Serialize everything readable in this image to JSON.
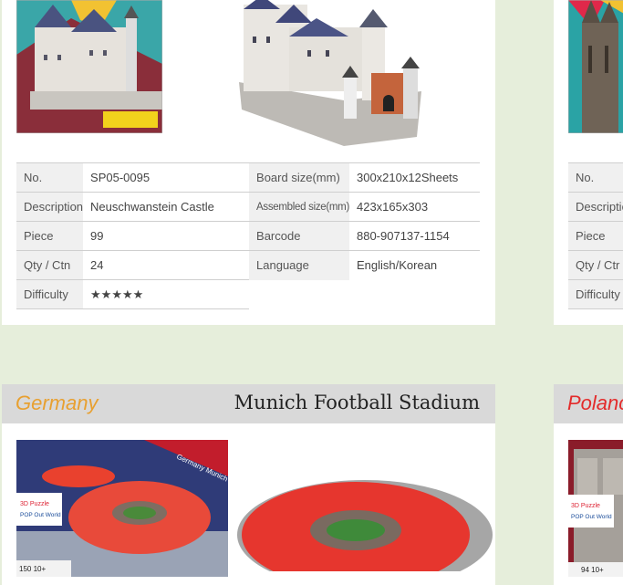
{
  "castle": {
    "spec_left": [
      {
        "label": "No.",
        "value": "SP05-0095"
      },
      {
        "label": "Description",
        "value": "Neuschwanstein Castle"
      },
      {
        "label": "Piece",
        "value": "99"
      },
      {
        "label": "Qty / Ctn",
        "value": "24"
      },
      {
        "label": "Difficulty",
        "value": "★★★★★"
      }
    ],
    "spec_right": [
      {
        "label": "Board size(mm)",
        "value": "300x210x12Sheets"
      },
      {
        "label": "Assembled size(mm)",
        "value": "423x165x303"
      },
      {
        "label": "Barcode",
        "value": "880-907137-1154"
      },
      {
        "label": "Language",
        "value": "English/Korean"
      }
    ]
  },
  "right_card_top": {
    "labels": [
      "No.",
      "Descriptior",
      "Piece",
      "Qty / Ctr",
      "Difficulty"
    ]
  },
  "stadium": {
    "country": "Germany",
    "title": "Munich Football Stadium",
    "box_ribbon": "Germany Munich Football Stadium",
    "logo_line1": "3D Puzzle",
    "logo_line2": "POP Out World",
    "box_pieces": "150  10+"
  },
  "right_card_bottom": {
    "country": "Polanc",
    "logo_line1": "3D Puzzle",
    "logo_line2": "POP Out World",
    "box_pieces": "94  10+"
  },
  "colors": {
    "page_bg": "#e6eedb",
    "header_bg": "#d9d9d9",
    "country_germany": "#e8a030",
    "country_poland": "#e32b2b"
  }
}
